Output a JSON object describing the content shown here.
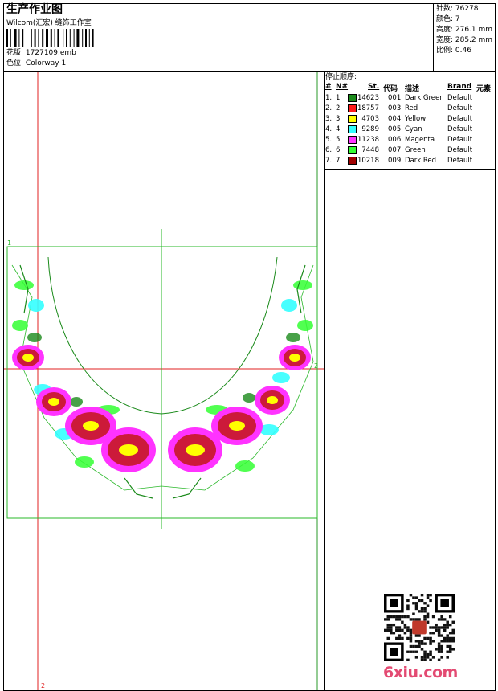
{
  "header": {
    "title": "生产作业图",
    "company": "Wilcom(汇宏) 缝饰工作室",
    "design_label": "花版:",
    "design_file": "1727109.emb",
    "colorway_label": "色位:",
    "colorway": "Colorway 1"
  },
  "stats": {
    "stitches": "针数: 76278",
    "colors": "颜色: 7",
    "height": "高度: 276.1 mm",
    "width": "宽度: 285.2 mm",
    "scale": "比例: 0.46"
  },
  "stop_sequence": {
    "title": "停止顺序:",
    "headers": {
      "index": "#",
      "needle": "N#",
      "stitches": "St.",
      "code": "代码",
      "description": "描述",
      "brand": "Brand",
      "element": "元素"
    },
    "rows": [
      {
        "index": "1.",
        "needle": "1",
        "color": "#1a8a1a",
        "stitches": "14623",
        "code": "001",
        "description": "Dark Green",
        "brand": "Default"
      },
      {
        "index": "2.",
        "needle": "2",
        "color": "#ff1a1a",
        "stitches": "18757",
        "code": "003",
        "description": "Red",
        "brand": "Default"
      },
      {
        "index": "3.",
        "needle": "3",
        "color": "#ffff00",
        "stitches": "4703",
        "code": "004",
        "description": "Yellow",
        "brand": "Default"
      },
      {
        "index": "4.",
        "needle": "4",
        "color": "#33ffff",
        "stitches": "9289",
        "code": "005",
        "description": "Cyan",
        "brand": "Default"
      },
      {
        "index": "5.",
        "needle": "5",
        "color": "#ff33ff",
        "stitches": "11238",
        "code": "006",
        "description": "Magenta",
        "brand": "Default"
      },
      {
        "index": "6.",
        "needle": "6",
        "color": "#33ff33",
        "stitches": "7448",
        "code": "007",
        "description": "Green",
        "brand": "Default"
      },
      {
        "index": "7.",
        "needle": "7",
        "color": "#a00000",
        "stitches": "10218",
        "code": "009",
        "description": "Dark Red",
        "brand": "Default"
      }
    ]
  },
  "guides": {
    "marker_1": "1",
    "marker_2_right": "2",
    "marker_2_bottom": "2"
  },
  "watermark": "6xiu.com",
  "icons": {
    "barcode": "barcode-icon",
    "qr": "qr-code-icon"
  }
}
